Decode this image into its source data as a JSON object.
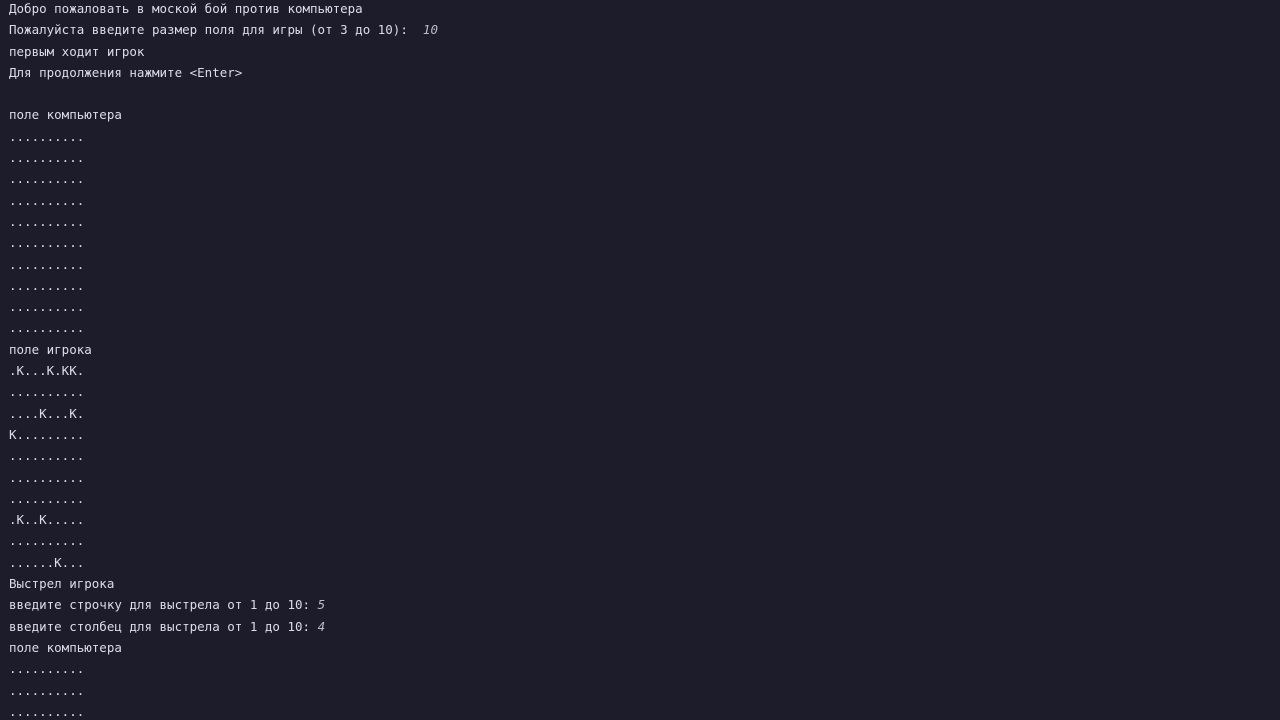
{
  "terminal": {
    "intro": {
      "welcome": "Добро пожаловать в моской бой против компьютера",
      "size_prompt": "Пожалуйста введите размер поля для игры (от 3 до 10):  ",
      "size_value": "10",
      "first_turn": "первым ходит игрок",
      "continue": "Для продолжения нажмите <Enter>"
    },
    "computer_field_1": {
      "title": "поле компьютера",
      "rows": [
        "..........",
        "..........",
        "..........",
        "..........",
        "..........",
        "..........",
        "..........",
        "..........",
        "..........",
        ".........."
      ]
    },
    "player_field": {
      "title": "поле игрока",
      "rows": [
        ".К...К.КК.",
        "..........",
        "....К...К.",
        "К.........",
        "..........",
        "..........",
        "..........",
        ".К..К.....",
        "..........",
        "......К..."
      ]
    },
    "shot": {
      "title": "Выстрел игрока",
      "row_prompt": "введите строчку для выстрела от 1 до 10: ",
      "row_value": "5",
      "col_prompt": "введите столбец для выстрела от 1 до 10: ",
      "col_value": "4"
    },
    "computer_field_2": {
      "title": "поле компьютера",
      "rows": [
        "..........",
        "..........",
        ".........."
      ]
    }
  }
}
